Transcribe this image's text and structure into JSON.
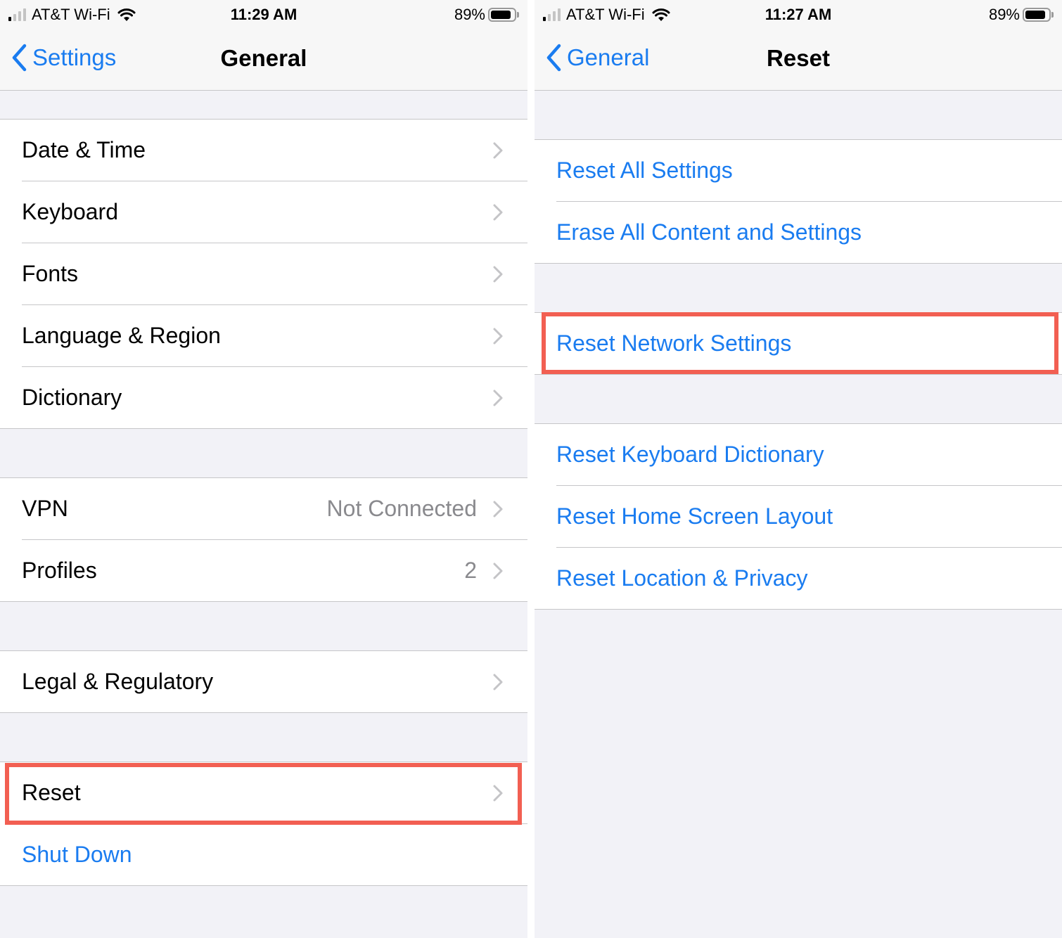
{
  "left_screen": {
    "status_bar": {
      "carrier": "AT&T Wi-Fi",
      "time": "11:29 AM",
      "battery_percent": "89%",
      "battery_level": 0.89,
      "signal_bars": 1
    },
    "nav": {
      "back_label": "Settings",
      "title": "General"
    },
    "groups": [
      {
        "rows": [
          {
            "label": "Date & Time",
            "detail": "",
            "chevron": true
          },
          {
            "label": "Keyboard",
            "detail": "",
            "chevron": true
          },
          {
            "label": "Fonts",
            "detail": "",
            "chevron": true
          },
          {
            "label": "Language & Region",
            "detail": "",
            "chevron": true
          },
          {
            "label": "Dictionary",
            "detail": "",
            "chevron": true
          }
        ]
      },
      {
        "rows": [
          {
            "label": "VPN",
            "detail": "Not Connected",
            "chevron": true
          },
          {
            "label": "Profiles",
            "detail": "2",
            "chevron": true
          }
        ]
      },
      {
        "rows": [
          {
            "label": "Legal & Regulatory",
            "detail": "",
            "chevron": true
          }
        ]
      },
      {
        "rows": [
          {
            "label": "Reset",
            "detail": "",
            "chevron": true,
            "highlighted": true
          },
          {
            "label": "Shut Down",
            "detail": "",
            "chevron": false,
            "style": "blue"
          }
        ]
      }
    ]
  },
  "right_screen": {
    "status_bar": {
      "carrier": "AT&T Wi-Fi",
      "time": "11:27 AM",
      "battery_percent": "89%",
      "battery_level": 0.89,
      "signal_bars": 1
    },
    "nav": {
      "back_label": "General",
      "title": "Reset"
    },
    "groups": [
      {
        "rows": [
          {
            "label": "Reset All Settings"
          },
          {
            "label": "Erase All Content and Settings"
          }
        ]
      },
      {
        "rows": [
          {
            "label": "Reset Network Settings",
            "highlighted": true
          }
        ]
      },
      {
        "rows": [
          {
            "label": "Reset Keyboard Dictionary"
          },
          {
            "label": "Reset Home Screen Layout"
          },
          {
            "label": "Reset Location & Privacy"
          }
        ]
      }
    ]
  },
  "colors": {
    "accent": "#1a7cf0",
    "highlight": "#f25f52",
    "background": "#f2f2f7",
    "separator": "#c6c6c8",
    "detail_text": "#8a8a8e"
  }
}
